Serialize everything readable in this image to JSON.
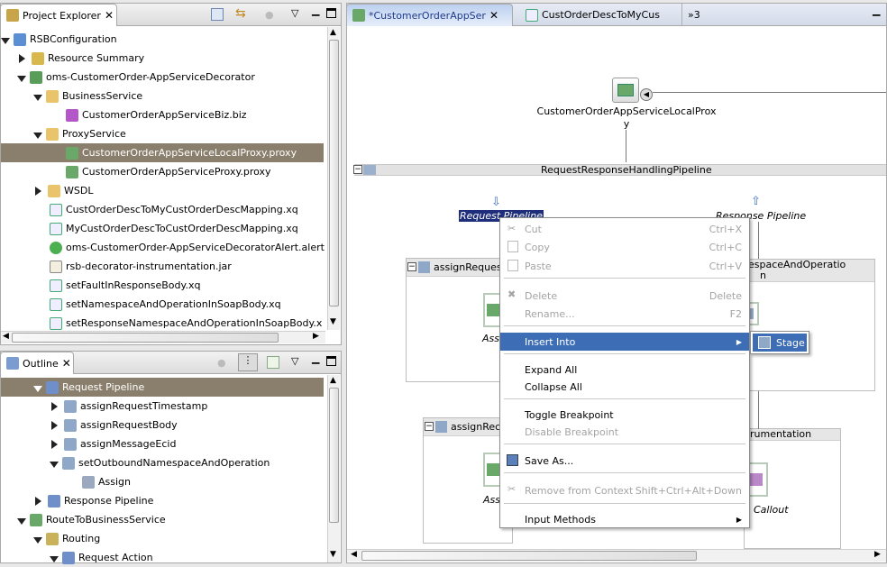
{
  "project_explorer": {
    "title": "Project Explorer",
    "items": [
      {
        "label": "RSBConfiguration"
      },
      {
        "label": "Resource Summary"
      },
      {
        "label": "oms-CustomerOrder-AppServiceDecorator"
      },
      {
        "label": "BusinessService"
      },
      {
        "label": "CustomerOrderAppServiceBiz.biz"
      },
      {
        "label": "ProxyService"
      },
      {
        "label": "CustomerOrderAppServiceLocalProxy.proxy"
      },
      {
        "label": "CustomerOrderAppServiceProxy.proxy"
      },
      {
        "label": "WSDL"
      },
      {
        "label": "CustOrderDescToMyCustOrderDescMapping.xq"
      },
      {
        "label": "MyCustOrderDescToCustOrderDescMapping.xq"
      },
      {
        "label": "oms-CustomerOrder-AppServiceDecoratorAlert.alert"
      },
      {
        "label": "rsb-decorator-instrumentation.jar"
      },
      {
        "label": "setFaultInResponseBody.xq"
      },
      {
        "label": "setNamespaceAndOperationInSoapBody.xq"
      },
      {
        "label": "setResponseNamespaceAndOperationInSoapBody.x"
      }
    ]
  },
  "outline": {
    "title": "Outline",
    "items": [
      {
        "label": "Request Pipeline"
      },
      {
        "label": "assignRequestTimestamp"
      },
      {
        "label": "assignRequestBody"
      },
      {
        "label": "assignMessageEcid"
      },
      {
        "label": "setOutboundNamespaceAndOperation"
      },
      {
        "label": "Assign"
      },
      {
        "label": "Response Pipeline"
      },
      {
        "label": "RouteToBusinessService"
      },
      {
        "label": "Routing"
      },
      {
        "label": "Request Action"
      }
    ]
  },
  "editor": {
    "tabs": [
      {
        "label": "*CustomerOrderAppSer"
      },
      {
        "label": "CustOrderDescToMyCus"
      },
      {
        "label": "»3"
      }
    ],
    "proxy_label_line1": "CustomerOrderAppServiceLocalProx",
    "proxy_label_line2": "y",
    "pipeline_label": "RequestResponseHandlingPipeline",
    "request_pipeline": "Request Pipeline",
    "response_pipeline": "Response Pipeline",
    "stage1_label": "assignReques",
    "stage2_label": "assignRec",
    "stage3_label_line1": "espaceAndOperatio",
    "stage3_label_line2": "n",
    "stage4_label": "rumentation",
    "assign1": "Assi",
    "assign2": "Assi",
    "callout": "Callout"
  },
  "context_menu": {
    "items": [
      {
        "label": "Cut",
        "accel": "Ctrl+X"
      },
      {
        "label": "Copy",
        "accel": "Ctrl+C"
      },
      {
        "label": "Paste",
        "accel": "Ctrl+V"
      },
      {
        "label": "Delete",
        "accel": "Delete"
      },
      {
        "label": "Rename...",
        "accel": "F2"
      },
      {
        "label": "Insert Into",
        "accel": ""
      },
      {
        "label": "Expand All",
        "accel": ""
      },
      {
        "label": "Collapse All",
        "accel": ""
      },
      {
        "label": "Toggle Breakpoint",
        "accel": ""
      },
      {
        "label": "Disable Breakpoint",
        "accel": ""
      },
      {
        "label": "Save As...",
        "accel": ""
      },
      {
        "label": "Remove from Context",
        "accel": "Shift+Ctrl+Alt+Down"
      },
      {
        "label": "Input Methods",
        "accel": ""
      }
    ],
    "submenu_item": "Stage"
  },
  "colors": {
    "selection": "#8a7f6c",
    "menu_highlight": "#3d6db5",
    "tab_active_text": "#1f3a8a"
  }
}
